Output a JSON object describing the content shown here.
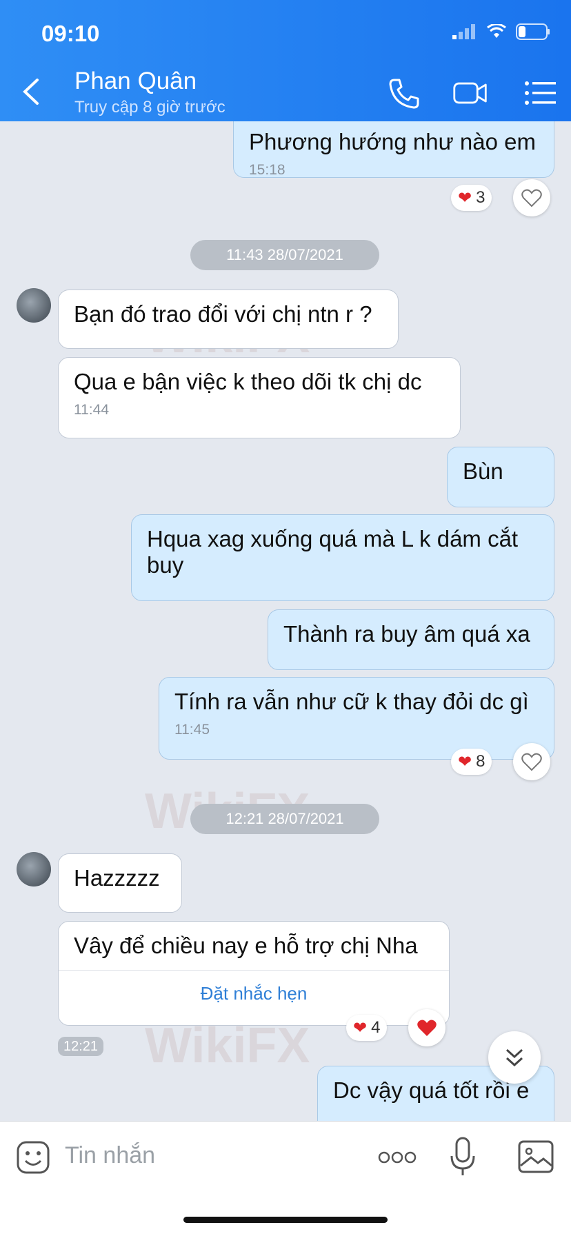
{
  "status_bar": {
    "time": "09:10"
  },
  "header": {
    "contact_name": "Phan Quân",
    "last_seen": "Truy cập 8 giờ trước",
    "icons": [
      "back-icon",
      "phone-icon",
      "video-icon",
      "menu-icon"
    ]
  },
  "messages": [
    {
      "dir": "out",
      "text": "Phương hướng như nào em",
      "time": "15:18",
      "reaction_count": "3"
    },
    {
      "type": "date",
      "text": "11:43 28/07/2021"
    },
    {
      "dir": "in",
      "text": "Bạn đó trao đổi với chị ntn r ?"
    },
    {
      "dir": "in",
      "text": "Qua e bận việc k theo dõi tk chị dc",
      "time": "11:44"
    },
    {
      "dir": "out",
      "text": "Bùn"
    },
    {
      "dir": "out",
      "text": "Hqua xag xuống quá mà L k dám cắt buy"
    },
    {
      "dir": "out",
      "text": "Thành ra buy âm quá xa"
    },
    {
      "dir": "out",
      "text": "Tính ra vẫn như cữ k thay đỏi dc gì",
      "time": "11:45",
      "reaction_count": "8"
    },
    {
      "type": "date",
      "text": "12:21 28/07/2021"
    },
    {
      "dir": "in",
      "text": "Hazzzzz"
    },
    {
      "dir": "in",
      "text": "Vây để  chiều nay e hỗ trợ chị Nha",
      "action": "Đặt nhắc hẹn",
      "time": "12:21",
      "reaction_count": "4"
    },
    {
      "dir": "out",
      "text": "Dc vậy quá tốt rồi e"
    }
  ],
  "watermark": "WikiFX",
  "composer": {
    "placeholder": "Tin nhắn"
  },
  "colors": {
    "header": "#1a74ee",
    "outgoing": "#d5ecfe",
    "incoming": "#ffffff",
    "background": "#e4e8ef",
    "heart": "#e0262b"
  }
}
